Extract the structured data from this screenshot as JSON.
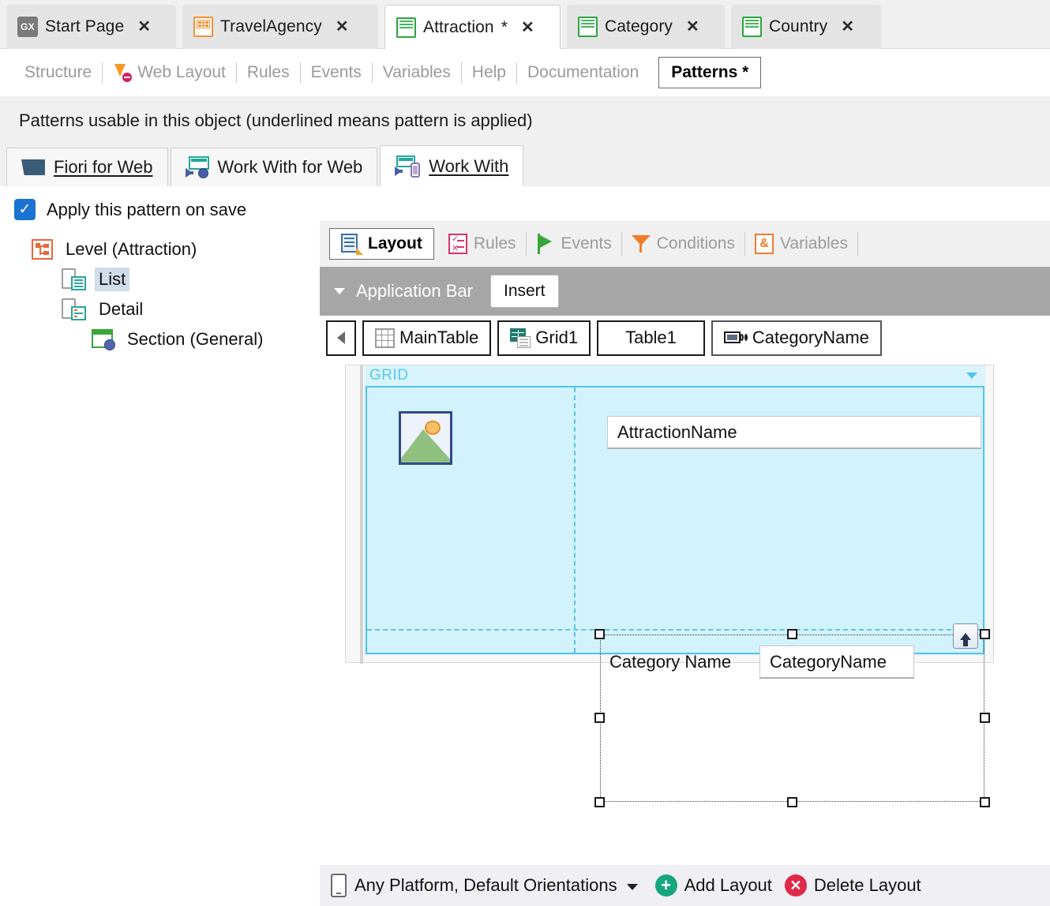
{
  "document_tabs": [
    {
      "label": "Start Page",
      "icon": "gx-logo-icon",
      "modified": false,
      "active": false
    },
    {
      "label": "TravelAgency",
      "icon": "transaction-orange-icon",
      "modified": false,
      "active": false
    },
    {
      "label": "Attraction",
      "icon": "transaction-green-icon",
      "modified": true,
      "active": true,
      "modified_mark": "*"
    },
    {
      "label": "Category",
      "icon": "transaction-green-icon",
      "modified": false,
      "active": false
    },
    {
      "label": "Country",
      "icon": "transaction-green-icon",
      "modified": false,
      "active": false
    }
  ],
  "close_glyph": "✕",
  "object_parts": [
    {
      "label": "Structure",
      "icon": null,
      "active": false
    },
    {
      "label": "Web Layout",
      "icon": "web-layout-icon",
      "active": false
    },
    {
      "label": "Rules",
      "icon": null,
      "active": false
    },
    {
      "label": "Events",
      "icon": null,
      "active": false
    },
    {
      "label": "Variables",
      "icon": null,
      "active": false
    },
    {
      "label": "Help",
      "icon": null,
      "active": false
    },
    {
      "label": "Documentation",
      "icon": null,
      "active": false
    },
    {
      "label": "Patterns *",
      "icon": null,
      "active": true
    }
  ],
  "patterns_note": "Patterns usable in this object (underlined means pattern is applied)",
  "pattern_tabs": [
    {
      "label": "Fiori for Web",
      "icon": "fiori-icon",
      "applied": true,
      "active": false
    },
    {
      "label": "Work With for Web",
      "icon": "work-with-web-icon",
      "applied": false,
      "active": false
    },
    {
      "label": "Work With",
      "icon": "work-with-mobile-icon",
      "applied": true,
      "active": true
    }
  ],
  "left_panel": {
    "apply_on_save": {
      "label": "Apply this pattern on save",
      "checked": true,
      "check_glyph": "✓"
    },
    "tree": [
      {
        "label": "Level (Attraction)",
        "icon": "level-node-icon",
        "indent": 0,
        "selected": false
      },
      {
        "label": "List",
        "icon": "list-node-icon",
        "indent": 1,
        "selected": true
      },
      {
        "label": "Detail",
        "icon": "detail-node-icon",
        "indent": 1,
        "selected": false
      },
      {
        "label": "Section (General)",
        "icon": "section-node-icon",
        "indent": 2,
        "selected": false
      }
    ]
  },
  "editor": {
    "tabs": [
      {
        "label": "Layout",
        "icon": "layout-icon",
        "active": true
      },
      {
        "label": "Rules",
        "icon": "rules-icon",
        "active": false
      },
      {
        "label": "Events",
        "icon": "events-flag-icon",
        "active": false
      },
      {
        "label": "Conditions",
        "icon": "conditions-funnel-icon",
        "active": false
      },
      {
        "label": "Variables",
        "icon": "variables-ampersand-icon",
        "active": false
      }
    ],
    "application_bar": {
      "label": "Application Bar",
      "insert_label": "Insert"
    },
    "breadcrumbs": [
      {
        "label": "MainTable",
        "icon": "main-table-icon"
      },
      {
        "label": "Grid1",
        "icon": "grid-icon"
      },
      {
        "label": "Table1",
        "icon": null
      },
      {
        "label": "CategoryName",
        "icon": "attribute-icon",
        "selected": true
      }
    ],
    "canvas": {
      "grid_title": "GRID",
      "image_placeholder": "image-placeholder-icon",
      "attraction_field": "AttractionName",
      "category_label": "Category Name",
      "category_field": "CategoryName",
      "move_up_button": "move-up-icon"
    }
  },
  "bottom_bar": {
    "platform_label": "Any Platform, Default Orientations",
    "add_layout": "Add Layout",
    "delete_layout": "Delete Layout",
    "plus_glyph": "+",
    "x_glyph": "✕"
  },
  "colors": {
    "accent_blue": "#1a72d1",
    "grid_fill": "#d2f2fd",
    "grid_border": "#54c4e8",
    "appbar_gray": "#a6a6a6",
    "green_icon": "#2aa641",
    "orange_icon": "#ef9235"
  }
}
